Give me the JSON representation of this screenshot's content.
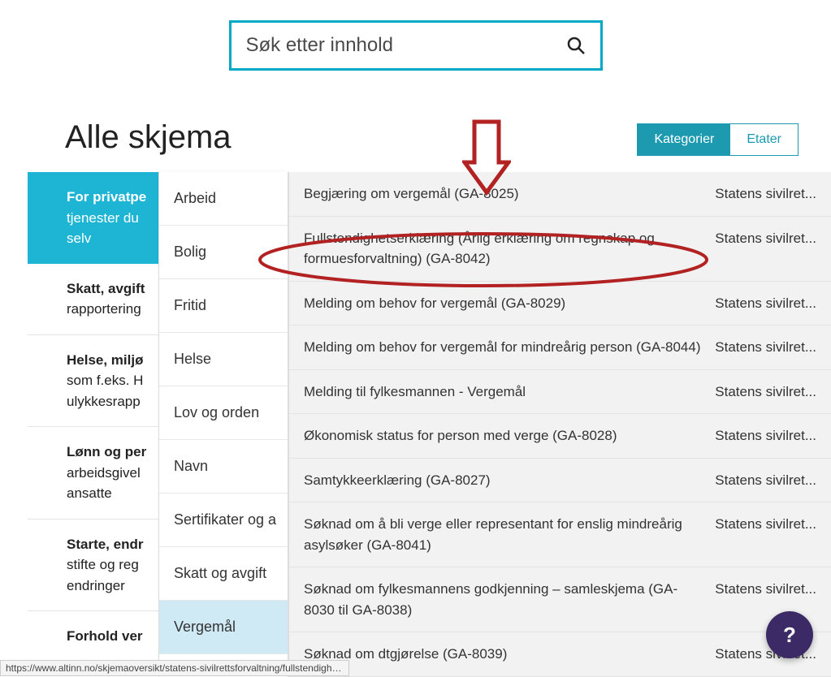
{
  "search": {
    "placeholder": "Søk etter innhold"
  },
  "page_title": "Alle skjema",
  "tabs": {
    "categories": "Kategorier",
    "agencies": "Etater"
  },
  "left_menu": [
    {
      "bold": "For privatpe",
      "rest": " tjenester du selv"
    },
    {
      "bold": "Skatt, avgift",
      "rest": " rapportering"
    },
    {
      "bold": "Helse, miljø",
      "rest": " som f.eks. H ulykkesrapp"
    },
    {
      "bold": "Lønn og per",
      "rest": " arbeidsgivel ansatte"
    },
    {
      "bold": "Starte, endr",
      "rest": " stifte og reg endringer"
    },
    {
      "bold": "Forhold ver",
      "rest": ""
    }
  ],
  "mid_menu": [
    "Arbeid",
    "Bolig",
    "Fritid",
    "Helse",
    "Lov og orden",
    "Navn",
    "Sertifikater og a",
    "Skatt og avgift",
    "Vergemål"
  ],
  "results": [
    {
      "title": "Begjæring om vergemål (GA-8025)",
      "agency": "Statens sivilret..."
    },
    {
      "title": "Fullstendighetserklæring (Årlig erklæring om regnskap og formuesforvaltning) (GA-8042)",
      "agency": "Statens sivilret..."
    },
    {
      "title": "Melding om behov for vergemål (GA-8029)",
      "agency": "Statens sivilret..."
    },
    {
      "title": "Melding om behov for vergemål for mindreårig person (GA-8044)",
      "agency": "Statens sivilret..."
    },
    {
      "title": "Melding til fylkesmannen - Vergemål",
      "agency": "Statens sivilret..."
    },
    {
      "title": "Økonomisk status for person med verge (GA-8028)",
      "agency": "Statens sivilret..."
    },
    {
      "title": "Samtykkeerklæring (GA-8027)",
      "agency": "Statens sivilret..."
    },
    {
      "title": "Søknad om å bli verge eller representant for enslig mindreårig asylsøker (GA-8041)",
      "agency": "Statens sivilret..."
    },
    {
      "title": "Søknad om fylkesmannens godkjenning – samleskjema (GA-8030 til GA-8038)",
      "agency": "Statens sivilret..."
    },
    {
      "title": "Søknad om               dtgjørelse (GA-8039)",
      "agency": "Statens sivilret..."
    }
  ],
  "help_label": "?",
  "status_url": "https://www.altinn.no/skjemaoversikt/statens-sivilrettsforvaltning/fullstendighetserklaring-arlig-erk...",
  "annotation_color": "#b22222"
}
